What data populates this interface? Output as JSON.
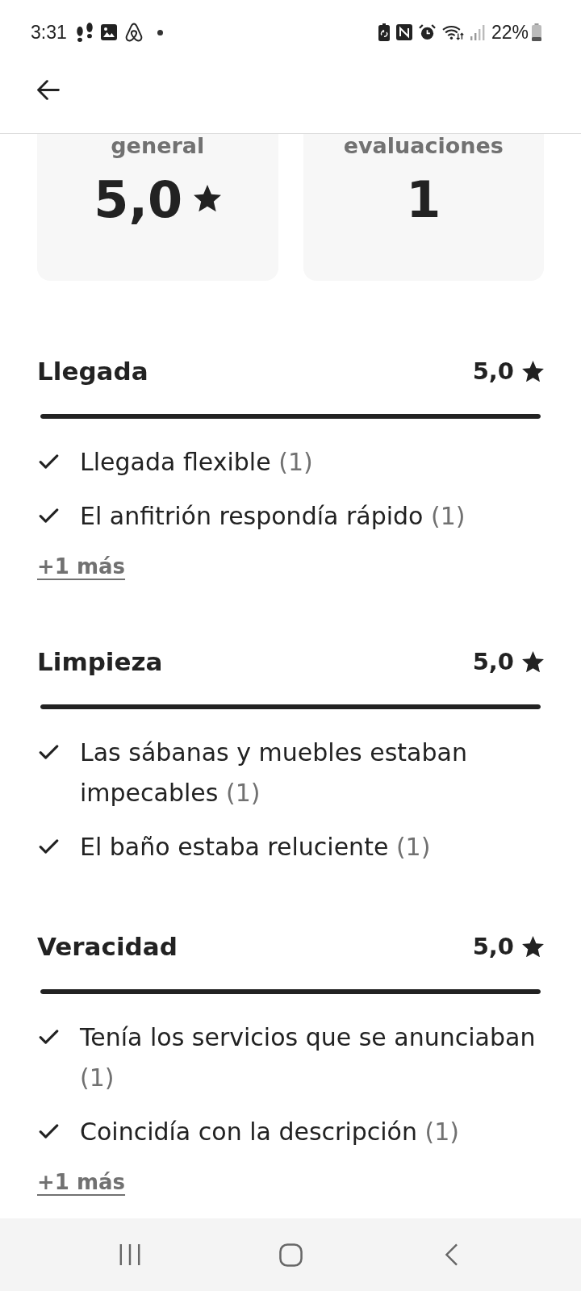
{
  "status_bar": {
    "time": "3:31",
    "battery_percent": "22%"
  },
  "summary_cards": [
    {
      "kind": "rating",
      "label": "general",
      "value": "5,0"
    },
    {
      "kind": "count",
      "label": "evaluaciones",
      "value": "1"
    }
  ],
  "categories": [
    {
      "title": "Llegada",
      "rating": "5,0",
      "level": 1,
      "highlights": [
        {
          "text": "Llegada flexible",
          "count": "(1)"
        },
        {
          "text": "El anfitrión respondía rápido",
          "count": "(1)"
        }
      ],
      "more_link": "+1 más"
    },
    {
      "title": "Limpieza",
      "rating": "5,0",
      "level": 1,
      "highlights": [
        {
          "text": "Las sábanas y muebles estaban impecables",
          "count": "(1)"
        },
        {
          "text": "El baño estaba reluciente",
          "count": "(1)"
        }
      ]
    },
    {
      "title": "Veracidad",
      "rating": "5,0",
      "level": 1,
      "highlights": [
        {
          "text": "Tenía los servicios que se anunciaban",
          "count": "(1)"
        },
        {
          "text": "Coincidía con la descripción",
          "count": "(1)"
        }
      ],
      "more_link": "+1 más"
    }
  ]
}
